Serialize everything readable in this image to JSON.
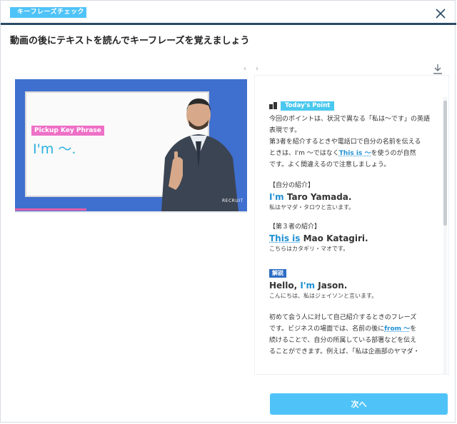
{
  "header": {
    "badge": "キーフレーズチェック",
    "instruction": "動画の後にテキストを読んでキーフレーズを覚えましょう"
  },
  "pager": {
    "prev": "‹",
    "next": "›"
  },
  "video": {
    "pickup_tag": "Pickup Key Phrase",
    "phrase": "I'm 〜.",
    "logo": "RECRUIT"
  },
  "panel": {
    "todays_point": "Today's Point",
    "intro": [
      "今回のポイントは、状況で異なる「私は〜です」の英語",
      "表現です。",
      "第3者を紹介するときや電話口で自分の名前を伝える"
    ],
    "intro_line4_pre": "ときは、I'm 〜ではなく",
    "intro_line4_hl": "This is 〜",
    "intro_line4_post": "を使うのが自然",
    "intro_line5": "です。よく間違えるので注意しましょう。",
    "ex1": {
      "label": "【自分の紹介】",
      "key": "I'm",
      "rest": "Taro Yamada.",
      "ja": "私はヤマダ・タロウと言います。"
    },
    "ex2": {
      "label": "【第３者の紹介】",
      "key": "This is",
      "rest": "Mao Katagiri.",
      "ja": "こちらはカタギリ・マオです。"
    },
    "kaisetsu": "解説",
    "ex3": {
      "pre": "Hello,",
      "key": "I'm",
      "rest": "Jason.",
      "ja": "こんにちは、私はジェイソンと言います。"
    },
    "explain_line1": "初めて会う人に対して自己紹介するときのフレーズ",
    "explain_line2_pre": "です。ビジネスの場面では、名前の後に",
    "explain_line2_hl": "from 〜",
    "explain_line2_post": "を",
    "explain_line3": "続けることで、自分の所属している部署などを伝え",
    "explain_line4": "ることができます。例えば、「私は企画部のヤマダ・"
  },
  "footer": {
    "next": "次へ"
  }
}
